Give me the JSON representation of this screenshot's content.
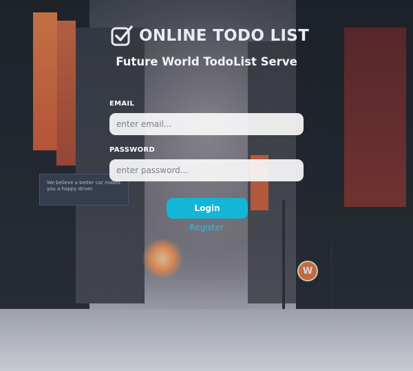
{
  "brand": {
    "title": "ONLINE TODO LIST",
    "icon": "checkbox-icon"
  },
  "subtitle": "Future World TodoList Serve",
  "form": {
    "email_label": "EMAIL",
    "email_placeholder": "enter email...",
    "email_value": "",
    "password_label": "PASSWORD",
    "password_placeholder": "enter password...",
    "password_value": "",
    "login_label": "Login",
    "register_label": "Register"
  },
  "background": {
    "billboard_text": "We believe a better car makes you a happy driver.",
    "sign_letter": "W"
  },
  "colors": {
    "accent": "#14b6d8",
    "link": "#2bbfe0",
    "text": "#ffffff"
  }
}
